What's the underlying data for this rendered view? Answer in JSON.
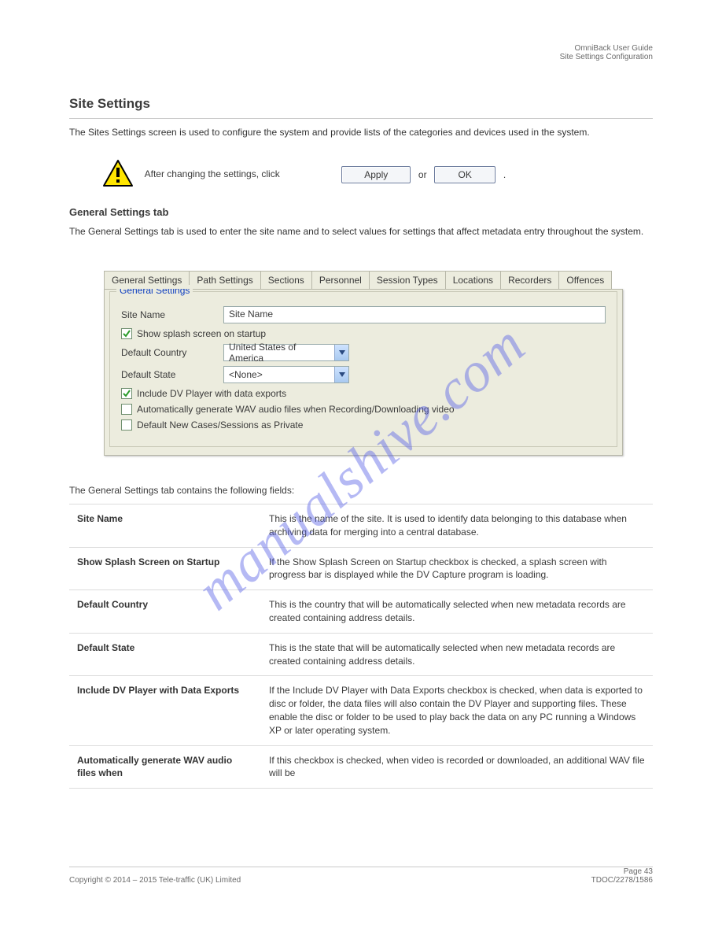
{
  "watermark": "manualshive.com",
  "header": {
    "right_top": "OmniBack User Guide",
    "right_bottom": "Site Settings Configuration"
  },
  "section_title": "Site Settings",
  "intro": "The Sites Settings screen is used to configure the system and provide lists of the categories and devices used in the system.",
  "warning": {
    "before": "After changing the settings, click ",
    "btn_apply": "Apply",
    "middle": " or ",
    "btn_ok": "OK",
    "after": "."
  },
  "sub1": "General Settings tab",
  "body2": "The General Settings tab is used to enter the site name and to select values for settings that affect metadata entry throughout the system.",
  "tabs": [
    "General Settings",
    "Path Settings",
    "Sections",
    "Personnel",
    "Session Types",
    "Locations",
    "Recorders",
    "Offences"
  ],
  "fieldset": {
    "legend": "General Settings",
    "site_name_label": "Site Name",
    "site_name_value": "Site Name",
    "chk_splash": "Show splash screen on startup",
    "country_label": "Default Country",
    "country_value": "United States of America",
    "state_label": "Default State",
    "state_value": "<None>",
    "chk_include": "Include DV Player with data exports",
    "chk_wav": "Automatically generate WAV audio files when Recording/Downloading video",
    "chk_private": "Default New Cases/Sessions as Private"
  },
  "table_intro": "The General Settings tab contains the following fields:",
  "rows": [
    {
      "k": "Site Name",
      "v": "This is the name of the site. It is used to identify data belonging to this database when archiving data for merging into a central database."
    },
    {
      "k": "Show Splash Screen on Startup",
      "v": "If the Show Splash Screen on Startup checkbox is checked, a splash screen with progress bar is displayed while the DV Capture program is loading."
    },
    {
      "k": "Default Country",
      "v": "This is the country that will be automatically selected when new metadata records are created containing address details."
    },
    {
      "k": "Default State",
      "v": "This is the state that will be automatically selected when new metadata records are created containing address details."
    },
    {
      "k": "Include DV Player with Data Exports",
      "v": "If the Include DV Player with Data Exports checkbox is checked, when data is exported to disc or folder, the data files will also contain the DV Player and supporting files. These enable the disc or folder to be used to play back the data on any PC running a Windows XP or later operating system."
    },
    {
      "k": "Automatically generate WAV audio files when",
      "v": "If this checkbox is checked, when video is recorded or downloaded, an additional WAV file will be"
    }
  ],
  "footer": {
    "left": "Copyright © 2014 – 2015 Tele-traffic (UK) Limited",
    "right_page": "Page 43",
    "right_ref": "TDOC/2278/1586"
  }
}
